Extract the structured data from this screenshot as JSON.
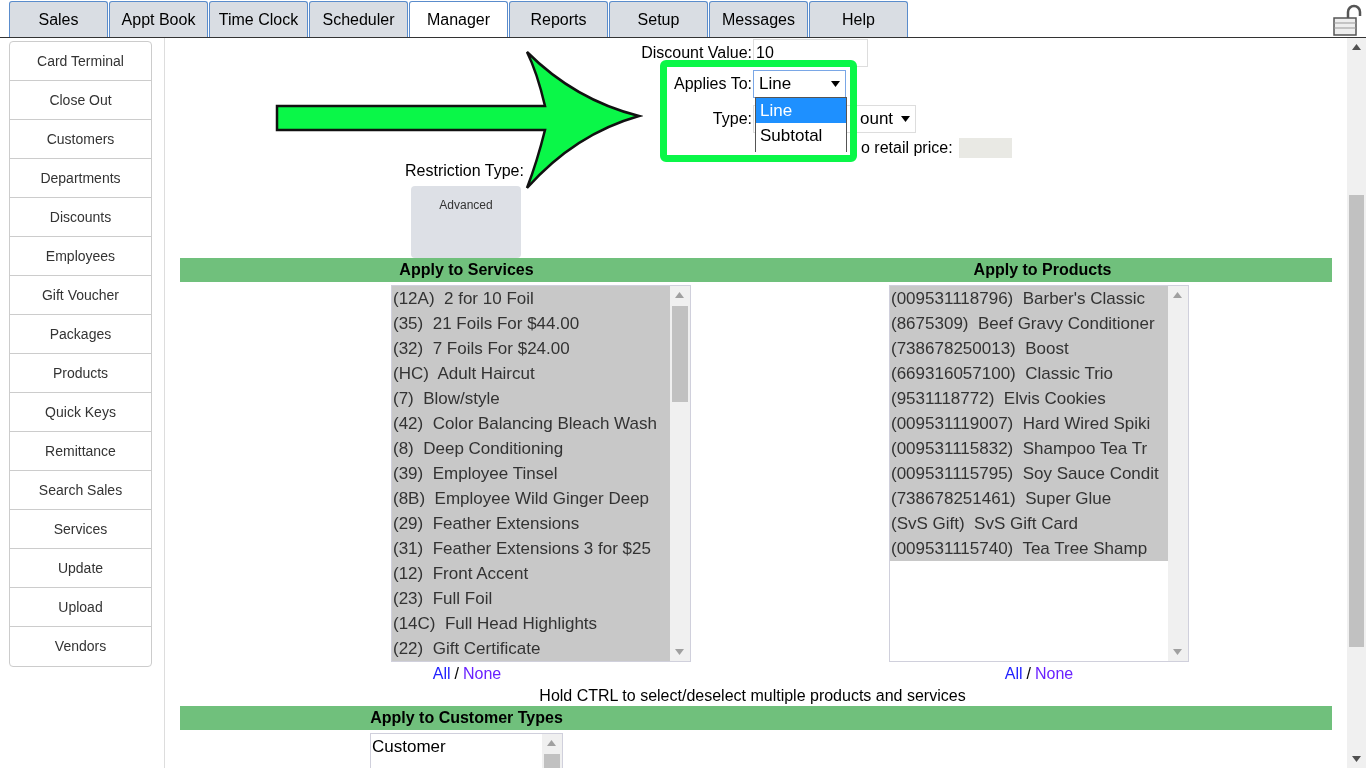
{
  "tabs": [
    {
      "label": "Sales",
      "selected": false
    },
    {
      "label": "Appt Book",
      "selected": false
    },
    {
      "label": "Time Clock",
      "selected": false
    },
    {
      "label": "Scheduler",
      "selected": false
    },
    {
      "label": "Manager",
      "selected": true
    },
    {
      "label": "Reports",
      "selected": false
    },
    {
      "label": "Setup",
      "selected": false
    },
    {
      "label": "Messages",
      "selected": false
    },
    {
      "label": "Help",
      "selected": false
    }
  ],
  "sidebar": {
    "items": [
      "Card Terminal",
      "Close Out",
      "Customers",
      "Departments",
      "Discounts",
      "Employees",
      "Gift Voucher",
      "Packages",
      "Products",
      "Quick Keys",
      "Remittance",
      "Search Sales",
      "Services",
      "Update",
      "Upload",
      "Vendors"
    ]
  },
  "form": {
    "discount_value": {
      "label": "Discount Value:",
      "value": "10"
    },
    "applies_to": {
      "label": "Applies To:",
      "value": "Line",
      "options": [
        {
          "label": "Line",
          "selected": true
        },
        {
          "label": "Subtotal",
          "selected": false
        }
      ]
    },
    "type": {
      "label": "Type:",
      "value": "ount"
    },
    "retail_price": {
      "label": "o retail price:"
    },
    "restriction_type": {
      "label": "Restriction Type:",
      "button": "Advanced"
    }
  },
  "services": {
    "heading": "Apply to Services",
    "items": [
      {
        "label": "(12A)  2 for 10 Foil",
        "selected": true
      },
      {
        "label": "(35)  21 Foils For $44.00",
        "selected": true
      },
      {
        "label": "(32)  7 Foils For $24.00",
        "selected": true
      },
      {
        "label": "(HC)  Adult Haircut",
        "selected": true
      },
      {
        "label": "(7)  Blow/style",
        "selected": true
      },
      {
        "label": "(42)  Color Balancing Bleach Wash",
        "selected": true
      },
      {
        "label": "(8)  Deep Conditioning",
        "selected": true
      },
      {
        "label": "(39)  Employee Tinsel",
        "selected": true
      },
      {
        "label": "(8B)  Employee Wild Ginger Deep",
        "selected": true
      },
      {
        "label": "(29)  Feather Extensions",
        "selected": true
      },
      {
        "label": "(31)  Feather Extensions 3 for $25",
        "selected": true
      },
      {
        "label": "(12)  Front Accent",
        "selected": true
      },
      {
        "label": "(23)  Full Foil",
        "selected": true
      },
      {
        "label": "(14C)  Full Head Highlights",
        "selected": true
      },
      {
        "label": "(22)  Gift Certificate",
        "selected": true
      }
    ],
    "all": "All",
    "sep": "/",
    "none": "None"
  },
  "products": {
    "heading": "Apply to Products",
    "items": [
      {
        "label": "(009531118796)  Barber's Classic",
        "selected": true
      },
      {
        "label": "(8675309)  Beef Gravy Conditioner",
        "selected": true
      },
      {
        "label": "(738678250013)  Boost",
        "selected": true
      },
      {
        "label": "(669316057100)  Classic Trio",
        "selected": true
      },
      {
        "label": "(9531118772)  Elvis Cookies",
        "selected": true
      },
      {
        "label": "(009531119007)  Hard Wired Spiki",
        "selected": true
      },
      {
        "label": "(009531115832)  Shampoo Tea Tr",
        "selected": true
      },
      {
        "label": "(009531115795)  Soy Sauce Condit",
        "selected": true
      },
      {
        "label": "(738678251461)  Super Glue",
        "selected": true
      },
      {
        "label": "(SvS Gift)  SvS Gift Card",
        "selected": true
      },
      {
        "label": "(009531115740)  Tea Tree Shamp",
        "selected": true
      }
    ],
    "all": "All",
    "sep": "/",
    "none": "None"
  },
  "hint": "Hold CTRL to select/deselect multiple products and services",
  "customer_types": {
    "heading": "Apply to Customer Types",
    "items": [
      {
        "label": "Customer",
        "selected": false
      }
    ]
  }
}
